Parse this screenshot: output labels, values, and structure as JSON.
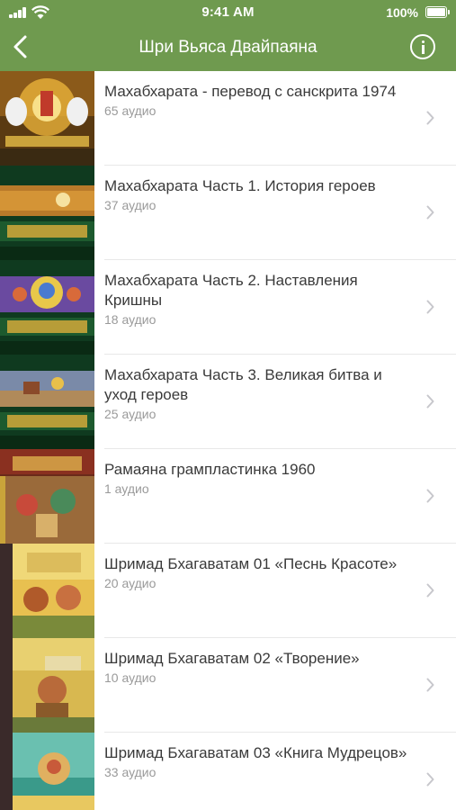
{
  "status_bar": {
    "time": "9:41 AM",
    "battery_percent": "100%",
    "signal_icon": "cellular-signal-icon",
    "wifi_icon": "wifi-icon",
    "battery_icon": "battery-icon"
  },
  "nav": {
    "title": "Шри Вьяса Двайпаяна",
    "back_icon": "chevron-left-icon",
    "info_icon": "info-icon"
  },
  "colors": {
    "header_bg": "#6f9a4f",
    "title_text": "#3a3a3a",
    "subtitle_text": "#9a9a9a",
    "chevron": "#c7c7cc"
  },
  "items": [
    {
      "title": "Махабхарата - перевод с санскрита 1974",
      "count": "65 аудио"
    },
    {
      "title": "Махабхарата Часть 1. История героев",
      "count": "37 аудио"
    },
    {
      "title": "Махабхарата Часть 2. Наставления Кришны",
      "count": "18 аудио"
    },
    {
      "title": "Махабхарата Часть 3. Великая битва и уход героев",
      "count": "25 аудио"
    },
    {
      "title": "Рамаяна грампластинка 1960",
      "count": "1 аудио"
    },
    {
      "title": "Шримад Бхагаватам 01 «Песнь Красоте»",
      "count": "20 аудио"
    },
    {
      "title": "Шримад Бхагаватам 02 «Творение»",
      "count": "10 аудио"
    },
    {
      "title": "Шримад Бхагаватам 03 «Книга Мудрецов»",
      "count": "33 аудио"
    }
  ]
}
